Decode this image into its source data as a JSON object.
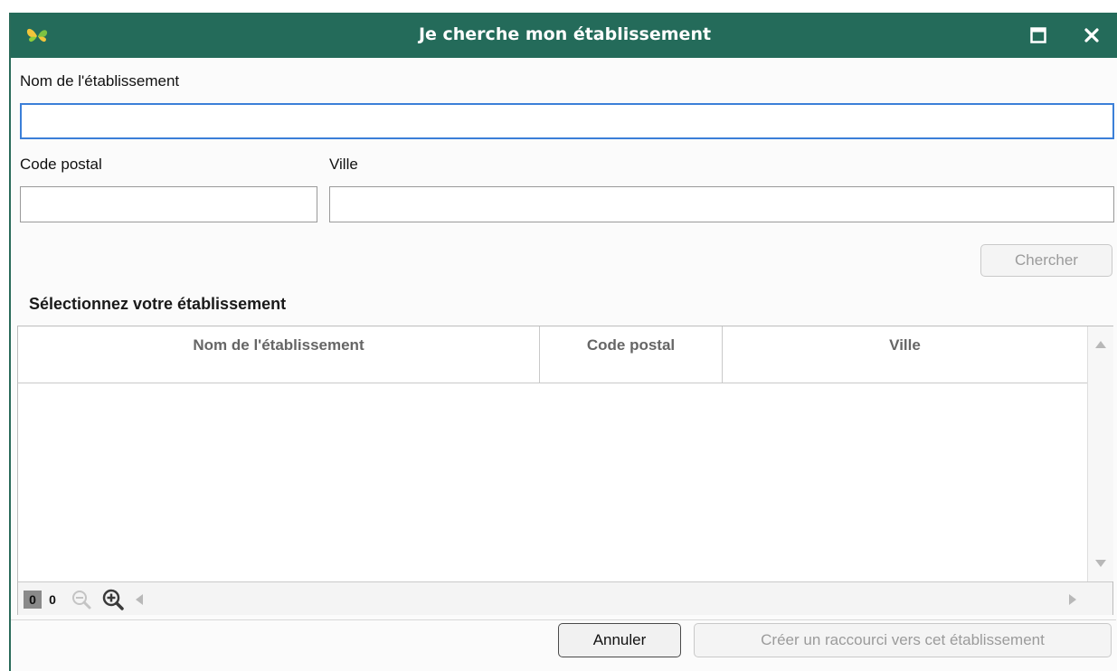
{
  "window": {
    "title": "Je cherche mon établissement",
    "accent_color": "#246b5a",
    "logo_icon": "butterfly-icon",
    "maximize_icon": "maximize-icon",
    "close_icon": "close-icon"
  },
  "form": {
    "name_label": "Nom de l'établissement",
    "name_value": "",
    "postal_label": "Code postal",
    "postal_value": "",
    "city_label": "Ville",
    "city_value": "",
    "search_button": "Chercher"
  },
  "results": {
    "section_title": "Sélectionnez votre établissement",
    "columns": [
      "Nom de l'établissement",
      "Code postal",
      "Ville"
    ],
    "rows": [],
    "count_selected": "0",
    "count_total": "0",
    "zoom_out_icon": "zoom-out-icon",
    "zoom_in_icon": "zoom-in-icon"
  },
  "footer": {
    "cancel_button": "Annuler",
    "create_shortcut_button": "Créer un raccourci vers cet établissement"
  }
}
